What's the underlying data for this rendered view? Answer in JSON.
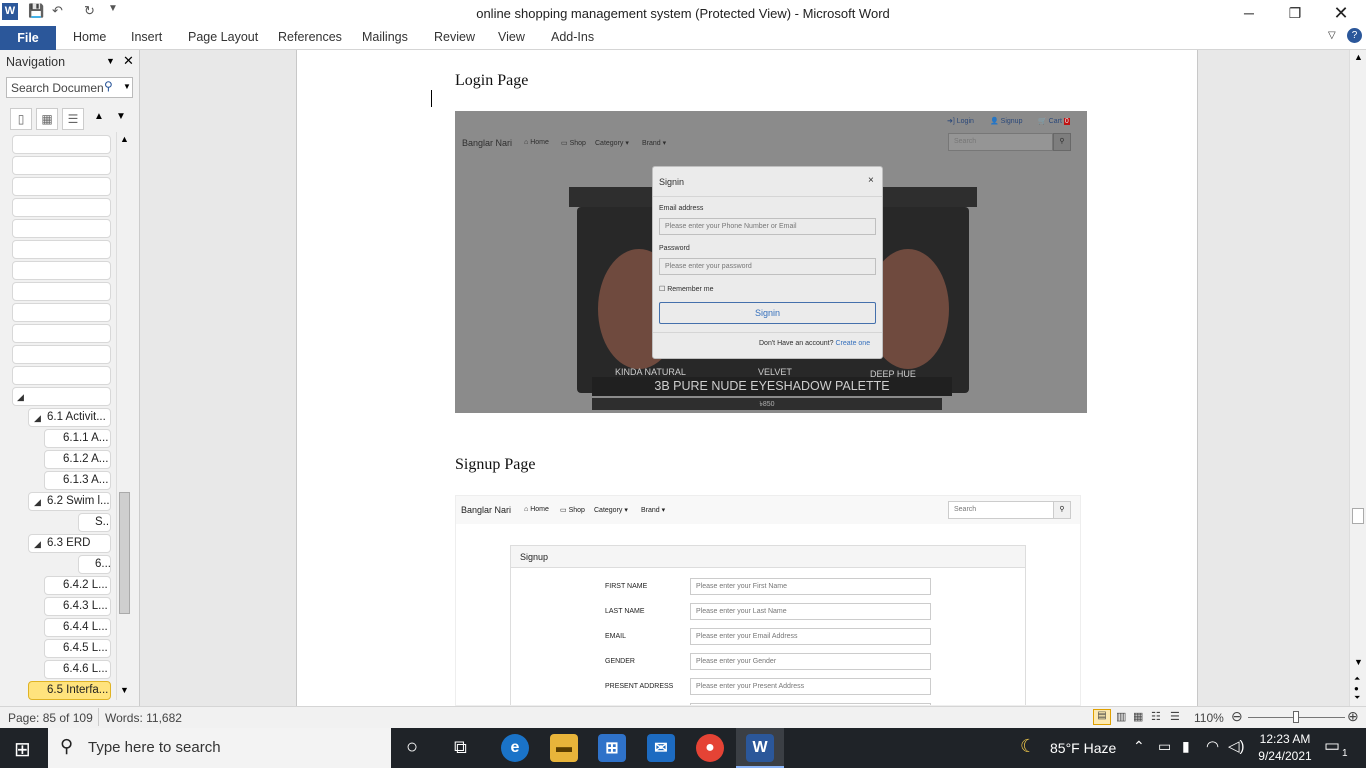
{
  "window": {
    "title": "online shopping management system (Protected View) - Microsoft Word"
  },
  "ribbon": {
    "file": "File",
    "tabs": [
      "Home",
      "Insert",
      "Page Layout",
      "References",
      "Mailings",
      "Review",
      "View",
      "Add-Ins"
    ]
  },
  "nav": {
    "title": "Navigation",
    "search_placeholder": "Search Documen",
    "items": [
      {
        "label": "6.1 Activit..."
      },
      {
        "label": "6.1.1 A..."
      },
      {
        "label": "6.1.2 A..."
      },
      {
        "label": "6.1.3 A..."
      },
      {
        "label": "6.2 Swim l..."
      },
      {
        "label": "S..."
      },
      {
        "label": "6.3 ERD"
      },
      {
        "label": "6..."
      },
      {
        "label": "6.4.2 L..."
      },
      {
        "label": "6.4.3 L..."
      },
      {
        "label": "6.4.4 L..."
      },
      {
        "label": "6.4.5 L..."
      },
      {
        "label": "6.4.6 L..."
      },
      {
        "label": "6.5 Interfa..."
      }
    ]
  },
  "document": {
    "login_heading": "Login Page",
    "signup_heading": "Signup Page"
  },
  "login_shot": {
    "brand": "Banglar Nari",
    "nav": [
      "Home",
      "Shop",
      "Category",
      "Brand"
    ],
    "top_links": [
      "Login",
      "Signup",
      "Cart"
    ],
    "cart_count": "0",
    "search": "Search",
    "modal": {
      "title": "Signin",
      "close": "×",
      "email_label": "Email address",
      "email_placeholder": "Please enter your Phone Number or Email",
      "password_label": "Password",
      "password_placeholder": "Please enter your password",
      "remember": "Remember me",
      "button": "Signin",
      "footer_text": "Don't Have an account?",
      "footer_link": "Create one"
    },
    "product": {
      "left": "KINDA NATURAL",
      "mid": "VELVET",
      "right": "DEEP HUE",
      "name": "3B PURE NUDE EYESHADOW PALETTE",
      "price": "৳850"
    }
  },
  "signup_shot": {
    "brand": "Banglar Nari",
    "nav": [
      "Home",
      "Shop",
      "Category",
      "Brand"
    ],
    "search": "Search",
    "card_title": "Signup",
    "fields": [
      {
        "label": "FIRST NAME",
        "placeholder": "Please enter your First Name"
      },
      {
        "label": "LAST NAME",
        "placeholder": "Please enter your Last Name"
      },
      {
        "label": "EMAIL",
        "placeholder": "Please enter your Email Address"
      },
      {
        "label": "GENDER",
        "placeholder": "Please enter your Gender"
      },
      {
        "label": "PRESENT ADDRESS",
        "placeholder": "Please enter your Present Address"
      }
    ]
  },
  "status": {
    "page": "Page: 85 of 109",
    "words": "Words: 11,682",
    "zoom": "110%"
  },
  "taskbar": {
    "search": "Type here to search",
    "weather": "85°F  Haze",
    "time": "12:23 AM",
    "date": "9/24/2021",
    "notifications": "1"
  },
  "colors": {
    "word_blue": "#2b579a",
    "nav_selected": "#ffe37d",
    "link": "#2a6fc9"
  }
}
